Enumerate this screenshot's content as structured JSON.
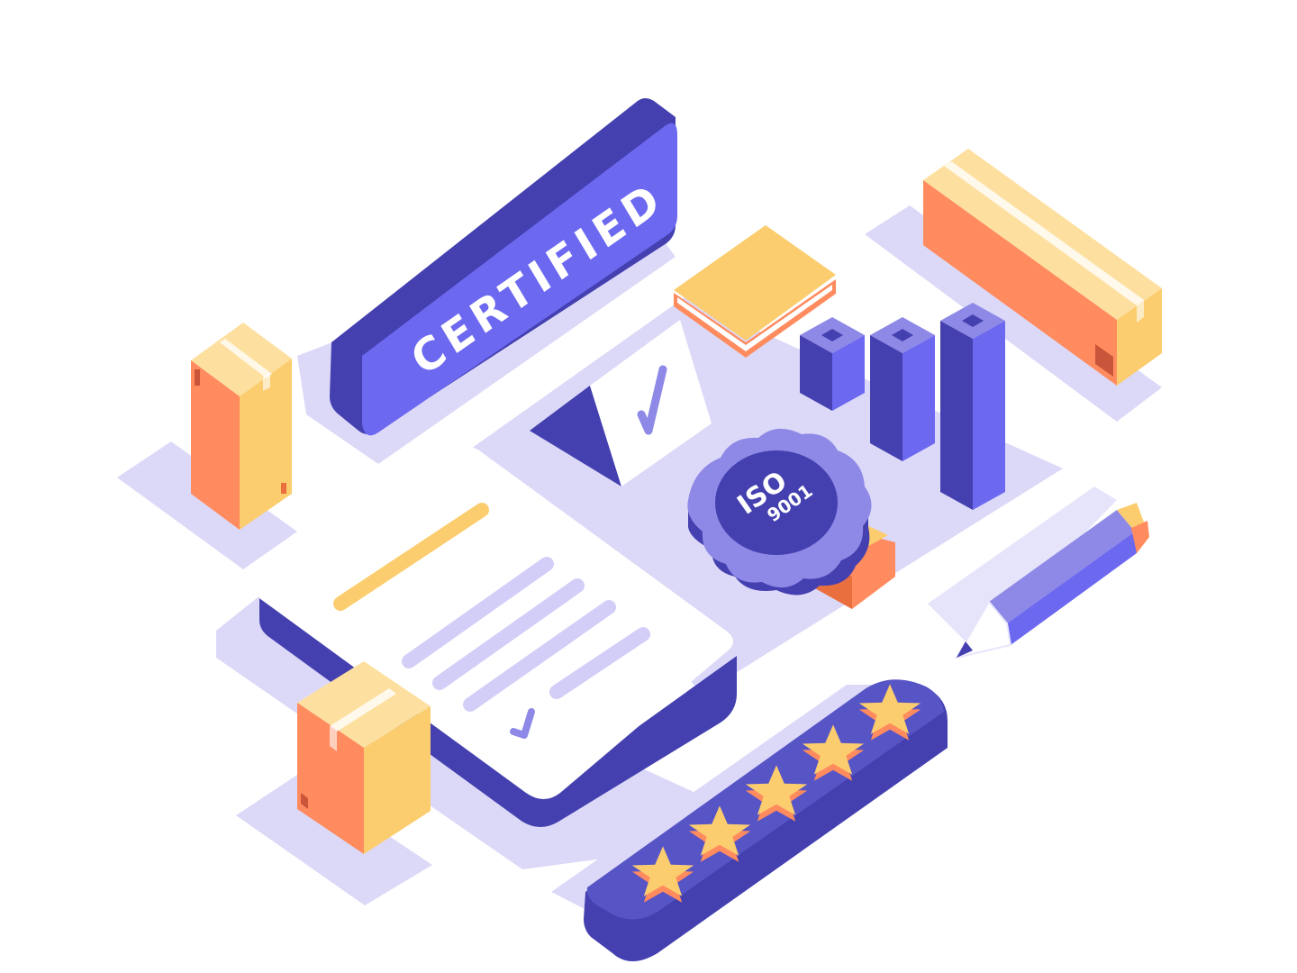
{
  "illustration": {
    "sign_text": "CERTIFIED",
    "badge_line1": "ISO",
    "badge_line2": "9001",
    "rating_stars": 5,
    "rating_max": 5
  },
  "colors": {
    "background": "#ffffff",
    "floor": "#d9d6f7",
    "indigo_dark": "#4440b0",
    "indigo": "#6c68f0",
    "indigo_mid": "#8e89e6",
    "lavender": "#c9c5f4",
    "orange": "#ff8b5e",
    "orange_dark": "#e96f3f",
    "yellow": "#fbcd6e",
    "yellow_light": "#fde0a0",
    "white": "#ffffff"
  },
  "icons": [
    "certified-sign",
    "clipboard-document",
    "checkmark-icon",
    "book-icon",
    "bar-chart",
    "iso-badge",
    "ribbon-icon",
    "pencil-icon",
    "star-icon",
    "cardboard-box"
  ]
}
